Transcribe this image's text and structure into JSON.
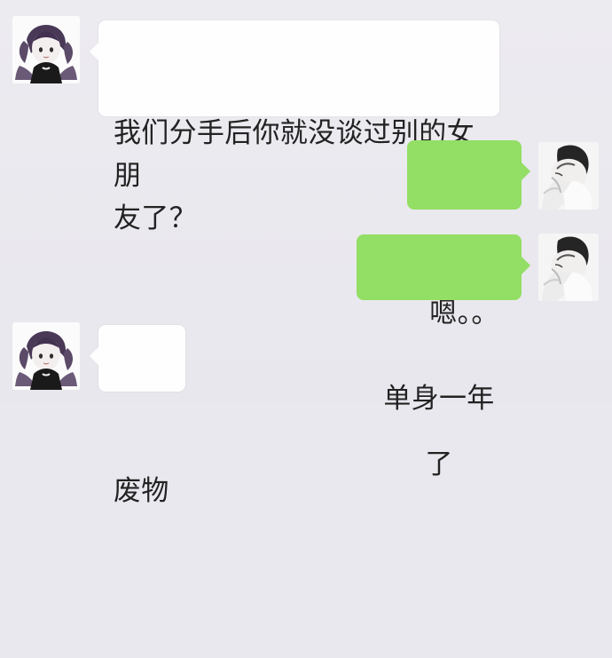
{
  "messages": [
    {
      "side": "left",
      "text": "我们分手后你就没谈过别的女朋\n友了？"
    },
    {
      "side": "right",
      "text": "嗯。。"
    },
    {
      "side": "right",
      "text": "单身一年了"
    },
    {
      "side": "left",
      "text": "废物"
    }
  ],
  "colors": {
    "background": "#e9e8ee",
    "incoming_bubble": "#fefefe",
    "outgoing_bubble": "#93de64"
  },
  "icons": {
    "left_avatar": "girl-avatar-icon",
    "right_avatar": "boy-avatar-icon"
  }
}
